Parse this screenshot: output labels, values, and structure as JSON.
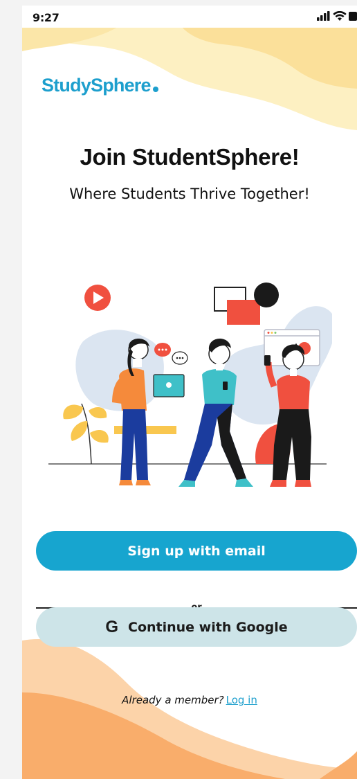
{
  "status_bar": {
    "time": "9:27",
    "icons": [
      "signal-icon",
      "wifi-icon",
      "battery-icon"
    ]
  },
  "brand": {
    "logo_text": "StudySphere",
    "accent_color": "#1d9fcd"
  },
  "hero": {
    "title": "Join StudentSphere!",
    "subtitle": "Where Students Thrive Together!"
  },
  "illustration": {
    "icon": "students-group-illustration"
  },
  "actions": {
    "email_button_label": "Sign up with email",
    "divider_text": "or",
    "google_icon": "G",
    "google_button_label": "Continue with Google"
  },
  "footer": {
    "member_text": "Already a member?",
    "login_link_label": "Log in"
  },
  "colors": {
    "primary_button": "#17a5cf",
    "secondary_button": "#cde4e8",
    "top_wave": "#fbe7a6",
    "bottom_wave": "#f9b27a"
  }
}
